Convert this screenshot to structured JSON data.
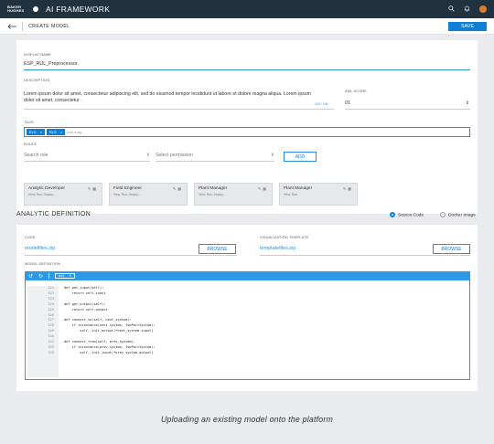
{
  "app": {
    "logo_text": "BAKER HUGHES",
    "name": "AI FRAMEWORK"
  },
  "topbar_icons": [
    "search-icon",
    "bell-icon",
    "user-avatar"
  ],
  "subheader": {
    "back_icon": "arrow-left-icon",
    "title": "CREATE MODEL",
    "save_label": "SAVE"
  },
  "form": {
    "display_name_label": "DISPLAY NAME",
    "display_name_value": "ESP_RUL_Preprocessor",
    "description_label": "DESCRIPTION",
    "description_value": "Lorem ipsum dolor sit amet, consectetur adipiscing elit, sed do eiusmod tempor incididunt ut labore et dolore magna aliqua. Lorem ipsum dolor sit amet, consectetur .",
    "char_count": "103 / 140",
    "aml_label": "AML SCORE",
    "aml_value": "01",
    "tags_label": "TAGS",
    "tags": [
      "ELS",
      "RLS"
    ],
    "tag_placeholder": "Add a tag...",
    "roles_label": "ROLES",
    "search_role_placeholder": "Search role",
    "permission_placeholder": "Select permission",
    "add_label": "ADD",
    "roles": [
      {
        "title": "Analytic Developer",
        "perms": "View, Run, Deploy..."
      },
      {
        "title": "Field Engineer",
        "perms": "View, Run, Deploy..."
      },
      {
        "title": "Plant Manager",
        "perms": "View, Run, Deploy..."
      },
      {
        "title": "Plant Manager",
        "perms": "View, Run"
      }
    ]
  },
  "analytic": {
    "title": "ANALYTIC DEFINITION",
    "source_code_label": "Source Code",
    "docker_image_label": "Docker Image",
    "code_label": "CODE",
    "code_file": "modelfiles.zip",
    "browse_label": "BROWSE",
    "vis_label": "VISUALIZATION TEMPLATE",
    "vis_file": "templatefiles.zip",
    "model_def_label": "MODEL DEFINITION",
    "language": "text",
    "line_numbers": [
      "521",
      "522",
      "523",
      "524",
      "525",
      "526",
      "527",
      "528",
      "529",
      "530",
      "531",
      "532",
      "533"
    ],
    "code": "def get_input(self):\n    return self.input\n\ndef get_output(self):\n    return self.output\n\ndef connect_to(self, next_system):\n    if isinstance(next_system, TwoPortSystem):\n        self._init_output(*next_system.input)\n\ndef connect_from(self, prev_system):\n    if isinstance(prev_system, TwoPortSystem):\n        self._init_input(*prev_system.output)"
  },
  "caption": "Uploading an existing model onto the platform"
}
